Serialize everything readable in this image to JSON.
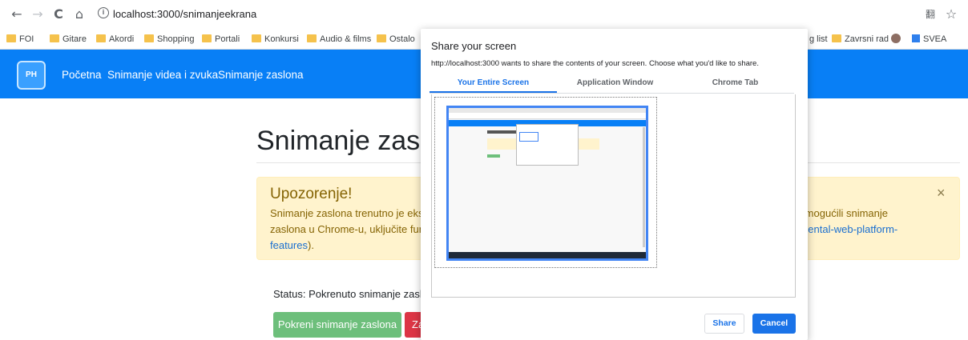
{
  "browser": {
    "url": "localhost:3000/snimanjeekrana",
    "back_icon": "←",
    "forward_icon": "→",
    "reload_icon": "C",
    "home_icon": "⌂",
    "info_icon": "i",
    "translate_icon": "翻",
    "star_icon": "☆"
  },
  "bookmarks": [
    "FOI",
    "Gitare",
    "Akordi",
    "Shopping",
    "Portali",
    "Konkursi",
    "Audio & films",
    "Ostalo",
    "g list",
    "Zavrsni rad",
    "SVEA"
  ],
  "navbar": {
    "logo_text": "PH",
    "links": [
      "Početna",
      "Snimanje videa i zvuka",
      "Snimanje zaslona"
    ]
  },
  "page": {
    "title": "Snimanje zaslona",
    "alert": {
      "heading": "Upozorenje!",
      "line1_left": "Snimanje zaslona trenutno je eksp",
      "line1_right": "te omogućili snimanje",
      "line2_left": "zaslona u Chrome-u, uključite funk",
      "line2_right": "erimental-web-platform-",
      "line3_link": "features",
      "line3_tail": ").",
      "close": "×"
    },
    "status": "Status: Pokrenuto snimanje zaslona",
    "start_button": "Pokreni snimanje zaslona",
    "stop_button": "Zaustavi"
  },
  "dialog": {
    "title": "Share your screen",
    "description": "http://localhost:3000 wants to share the contents of your screen. Choose what you'd like to share.",
    "tabs": [
      "Your Entire Screen",
      "Application Window",
      "Chrome Tab"
    ],
    "active_tab": 0,
    "share": "Share",
    "cancel": "Cancel"
  },
  "colors": {
    "navbar": "#087ff6",
    "alert_bg": "#fff3cd",
    "accent": "#1a73e8",
    "success": "#6dbf7b",
    "danger": "#dc3545"
  }
}
